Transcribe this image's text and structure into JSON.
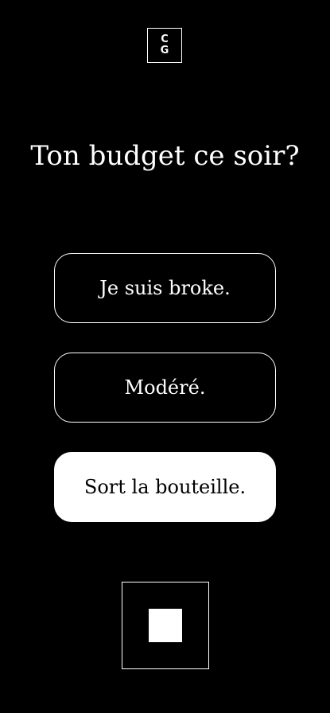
{
  "logo": {
    "line1": "C",
    "line2": "G"
  },
  "question": {
    "title": "Ton budget ce soir?"
  },
  "options": [
    {
      "label": "Je suis broke.",
      "selected": false
    },
    {
      "label": "Modéré.",
      "selected": false
    },
    {
      "label": "Sort la bouteille.",
      "selected": true
    }
  ],
  "controls": {
    "stop_icon": "stop-square-icon"
  },
  "colors": {
    "background": "#000000",
    "foreground": "#ffffff",
    "selected_text": "#000000"
  }
}
